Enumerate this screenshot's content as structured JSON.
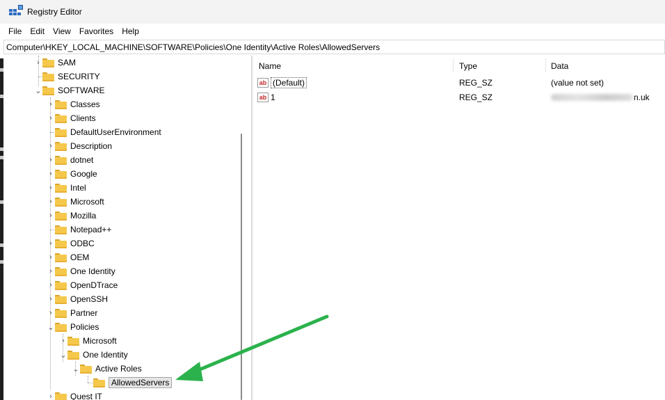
{
  "window": {
    "title": "Registry Editor"
  },
  "menu": [
    "File",
    "Edit",
    "View",
    "Favorites",
    "Help"
  ],
  "address": "Computer\\HKEY_LOCAL_MACHINE\\SOFTWARE\\Policies\\One Identity\\Active Roles\\AllowedServers",
  "tree": {
    "sam": "SAM",
    "security": "SECURITY",
    "software": "SOFTWARE",
    "classes": "Classes",
    "clients": "Clients",
    "defaultuserenv": "DefaultUserEnvironment",
    "description": "Description",
    "dotnet": "dotnet",
    "google": "Google",
    "intel": "Intel",
    "microsoft": "Microsoft",
    "mozilla": "Mozilla",
    "notepadpp": "Notepad++",
    "odbc": "ODBC",
    "oem": "OEM",
    "oneidentity": "One Identity",
    "opendtrace": "OpenDTrace",
    "openssh": "OpenSSH",
    "partner": "Partner",
    "policies": "Policies",
    "policies_microsoft": "Microsoft",
    "policies_oneidentity": "One Identity",
    "activeroles": "Active Roles",
    "allowedservers": "AllowedServers",
    "questit": "Quest IT"
  },
  "values": {
    "columns": {
      "name": "Name",
      "type": "Type",
      "data": "Data"
    },
    "rows": [
      {
        "name": "(Default)",
        "type": "REG_SZ",
        "data": "(value not set)"
      },
      {
        "name": "1",
        "type": "REG_SZ",
        "data_suffix": "n.uk"
      }
    ],
    "icon_text": "ab"
  },
  "colors": {
    "arrow": "#2bb24c",
    "folder": "#f5c84c"
  }
}
